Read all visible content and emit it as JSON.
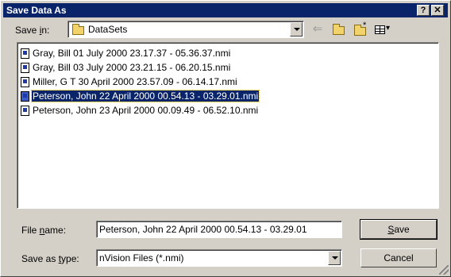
{
  "window": {
    "title": "Save Data As",
    "help_glyph": "?",
    "close_glyph": "✕"
  },
  "save_in": {
    "label_pre": "Save ",
    "label_accel": "i",
    "label_post": "n:",
    "value": "DataSets"
  },
  "toolbar": {
    "back_glyph": "⇐",
    "views_glyph": "▾"
  },
  "files": [
    {
      "name": "Gray, Bill  01 July 2000 23.17.37 - 05.36.37.nmi",
      "selected": false
    },
    {
      "name": "Gray, Bill  03 July 2000 23.21.15 - 06.20.15.nmi",
      "selected": false
    },
    {
      "name": "Miller, G T 30 April 2000 23.57.09 - 06.14.17.nmi",
      "selected": false
    },
    {
      "name": "Peterson, John  22 April 2000 00.54.13 - 03.29.01.nmi",
      "selected": true
    },
    {
      "name": "Peterson, John 23 April 2000 00.09.49 - 06.52.10.nmi",
      "selected": false
    }
  ],
  "file_name": {
    "label_pre": "File ",
    "label_accel": "n",
    "label_post": "ame:",
    "value": "Peterson, John  22 April 2000 00.54.13 - 03.29.01"
  },
  "save_type": {
    "label_pre": "Save as ",
    "label_accel": "t",
    "label_post": "ype:",
    "value": "nVision Files (*.nmi)"
  },
  "buttons": {
    "save_accel": "S",
    "save_rest": "ave",
    "cancel": "Cancel"
  }
}
